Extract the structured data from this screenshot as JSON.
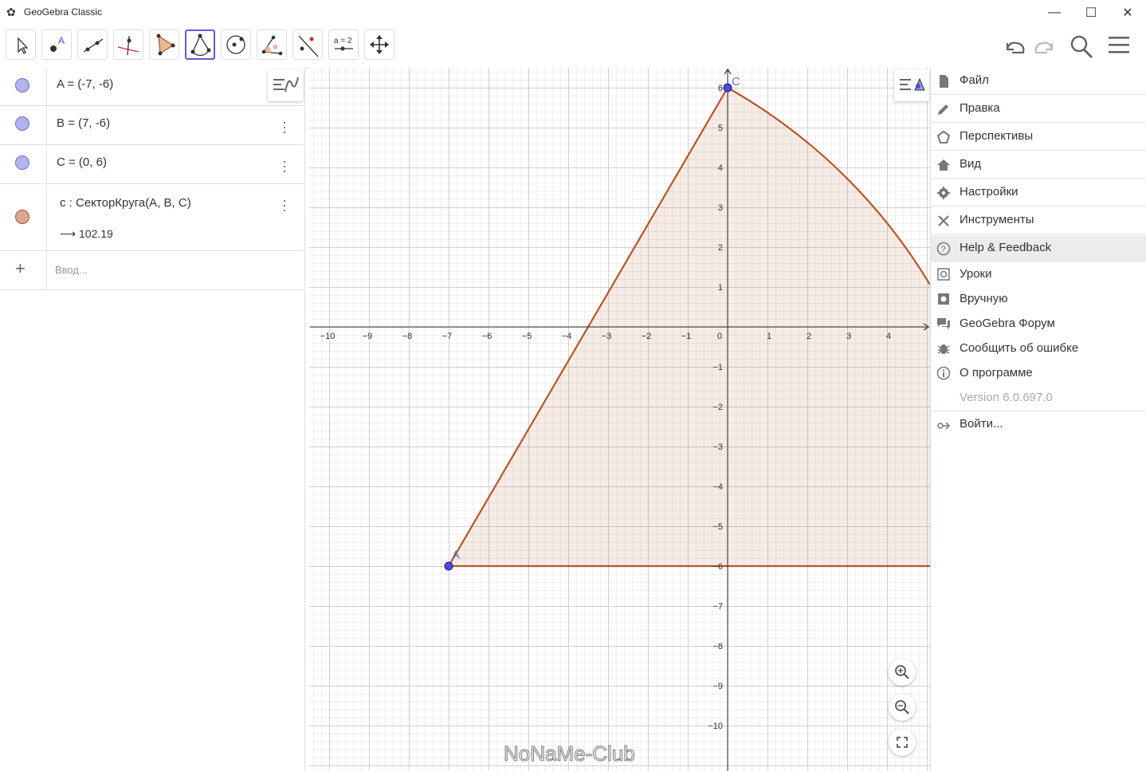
{
  "window": {
    "title": "GeoGebra Classic",
    "minimize": "—",
    "maximize": "☐",
    "close": "✕"
  },
  "toolbar": {
    "tools": [
      "move-tool",
      "point-tool",
      "line-tool",
      "perpendicular-tool",
      "polygon-tool",
      "circular-sector-tool",
      "circle-tool",
      "angle-tool",
      "reflect-tool",
      "slider-tool",
      "move-view-tool"
    ],
    "slider_label": "a = 2",
    "active_tool": "circular-sector-tool"
  },
  "algebra": {
    "rows": [
      {
        "definition": "A = (-7, -6)",
        "color": "#b3b3f0"
      },
      {
        "definition": "B = (7, -6)",
        "color": "#b3b3f0"
      },
      {
        "definition": "C = (0, 6)",
        "color": "#b3b3f0"
      },
      {
        "definition": "c : СекторКруга(A, B, C)",
        "value": "102.19",
        "color": "#d9a98f"
      }
    ],
    "input_placeholder": "Ввод..."
  },
  "graphics": {
    "x_ticks": [
      "−10",
      "−9",
      "−8",
      "−7",
      "−6",
      "−5",
      "−4",
      "−3",
      "−2",
      "−1",
      "0",
      "1",
      "2",
      "3",
      "4"
    ],
    "y_ticks_pos": [
      "6",
      "5",
      "4",
      "3",
      "2",
      "1"
    ],
    "y_ticks_neg": [
      "−1",
      "−2",
      "−3",
      "−4",
      "−5",
      "−6",
      "−7",
      "−8",
      "−9",
      "−10"
    ],
    "point_labels": {
      "A": "A",
      "C": "C"
    },
    "sector_color": "#b5572a",
    "point_color": "#4c4cd9"
  },
  "menu": {
    "items": [
      {
        "label": "Файл",
        "icon": "file-icon"
      },
      {
        "label": "Правка",
        "icon": "pencil-icon"
      },
      {
        "label": "Перспективы",
        "icon": "perspectives-icon"
      },
      {
        "label": "Вид",
        "icon": "home-icon"
      },
      {
        "label": "Настройки",
        "icon": "gear-icon"
      },
      {
        "label": "Инструменты",
        "icon": "tools-icon"
      },
      {
        "label": "Help & Feedback",
        "icon": "help-icon"
      }
    ],
    "help_items": [
      {
        "label": "Уроки",
        "icon": "tutorials-icon"
      },
      {
        "label": "Вручную",
        "icon": "manual-icon"
      },
      {
        "label": "GeoGebra Форум",
        "icon": "forum-icon"
      },
      {
        "label": "Сообщить об ошибке",
        "icon": "bug-icon"
      },
      {
        "label": "О программе",
        "icon": "info-icon"
      }
    ],
    "version": "Version 6.0.697.0",
    "sign_in": "Войти..."
  },
  "watermark": "NoNaMe-Club"
}
